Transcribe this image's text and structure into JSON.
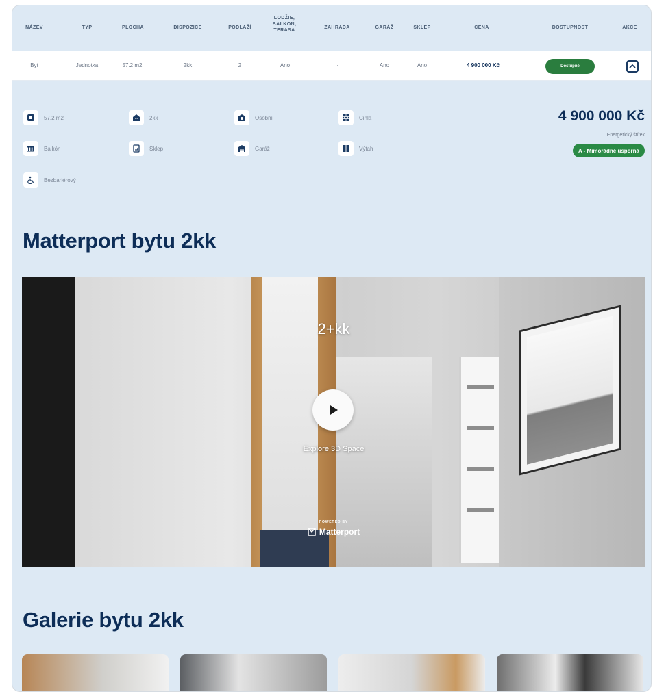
{
  "table": {
    "headers": [
      "NÁZEV",
      "TYP",
      "PLOCHA",
      "DISPOZICE",
      "PODLAŽÍ",
      "LODŽIE, BALKON, TERASA",
      "ZAHRADA",
      "GARÁŽ",
      "SKLEP",
      "CENA",
      "DOSTUPNOST",
      "AKCE"
    ],
    "row": {
      "name": "Byt",
      "type": "Jednotka",
      "area": "57.2 m2",
      "layout": "2kk",
      "floor": "2",
      "balcony": "Ano",
      "garden": "-",
      "garage": "Ano",
      "cellar": "Ano",
      "price": "4 900 000 Kč",
      "availability": "Dostupné"
    }
  },
  "features": [
    {
      "icon": "area-icon",
      "label": "57.2 m2"
    },
    {
      "icon": "building-icon",
      "label": "2kk"
    },
    {
      "icon": "ownership-icon",
      "label": "Osobní"
    },
    {
      "icon": "brick-icon",
      "label": "Cihla"
    },
    {
      "icon": "balcony-icon",
      "label": "Balkón"
    },
    {
      "icon": "cellar-icon",
      "label": "Sklep"
    },
    {
      "icon": "garage-icon",
      "label": "Garáž"
    },
    {
      "icon": "elevator-icon",
      "label": "Výtah"
    },
    {
      "icon": "wheelchair-icon",
      "label": "Bezbariérový"
    }
  ],
  "summary": {
    "price": "4 900 000 Kč",
    "energy_label": "Energetický štítek",
    "energy_value": "A - Mimořádně úsporná"
  },
  "matterport": {
    "heading": "Matterport bytu 2kk",
    "title": "2+kk",
    "explore": "Explore 3D Space",
    "powered": "POWERED BY",
    "brand": "Matterport"
  },
  "gallery": {
    "heading": "Galerie bytu 2kk"
  },
  "colors": {
    "bg": "#dde9f4",
    "navy": "#0d2d57",
    "green": "#2a7d3e"
  }
}
